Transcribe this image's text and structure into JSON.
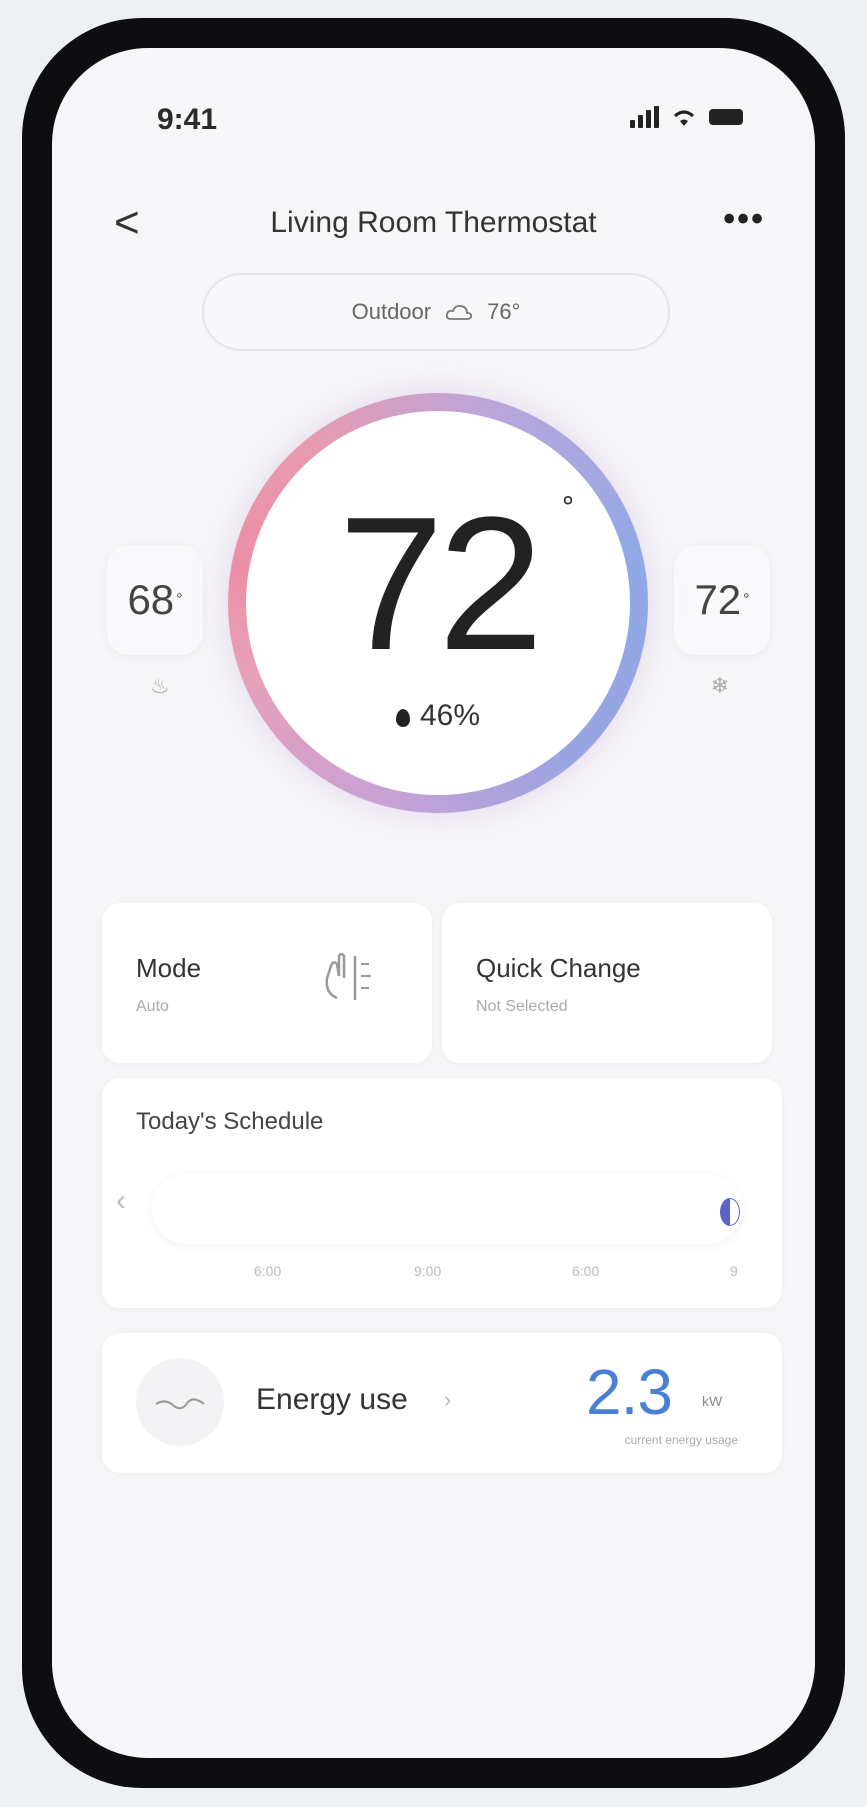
{
  "status": {
    "time": "9:41"
  },
  "nav": {
    "back_label": "<",
    "title": "Living Room Thermostat",
    "more_label": "•••"
  },
  "outdoor": {
    "label": "Outdoor",
    "icon": "cloud-icon",
    "temp": "76°"
  },
  "dial": {
    "temperature": "72",
    "degree": "°",
    "humidity": "46%"
  },
  "setpoints": {
    "heat": {
      "value": "68",
      "icon": "flame-icon"
    },
    "cool": {
      "value": "72",
      "icon": "snowflake-icon"
    }
  },
  "mode": {
    "title": "Mode",
    "value": "Auto",
    "icon": "mode-icon"
  },
  "quick_change": {
    "title": "Quick Change",
    "value": "Not Selected"
  },
  "schedule": {
    "title": "Today's Schedule",
    "ticks": [
      "6:00",
      "9:00",
      "6:00",
      "9"
    ]
  },
  "energy": {
    "label": "Energy use",
    "value": "2.3",
    "unit": "kW",
    "caption": "current energy usage"
  },
  "colors": {
    "accent": "#4a7fd3",
    "heat": "#e89aaf",
    "cool": "#8fa9e6"
  }
}
